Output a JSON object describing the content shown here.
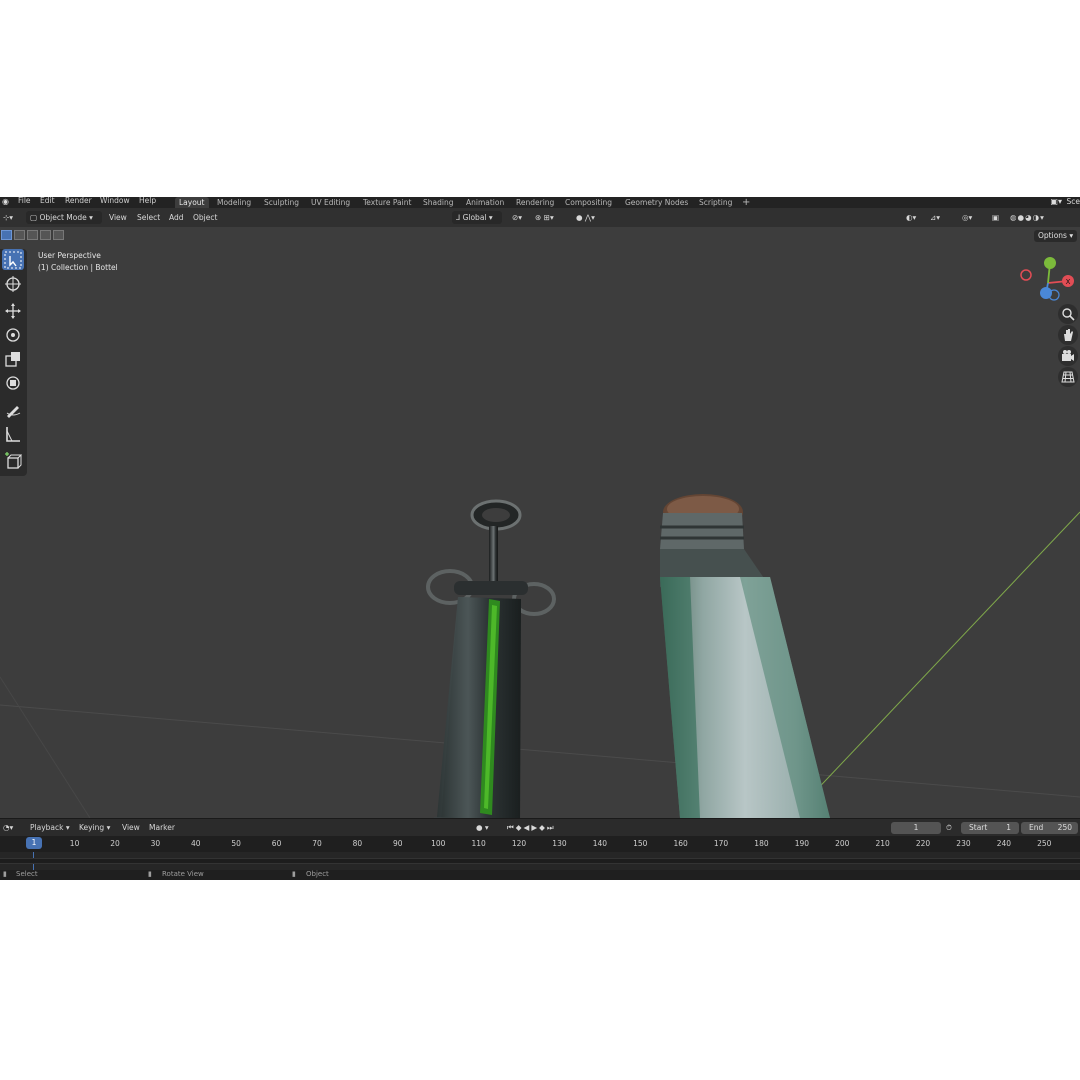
{
  "topbar": {
    "menus": [
      "File",
      "Edit",
      "Render",
      "Window",
      "Help"
    ],
    "workspaces": [
      "Layout",
      "Modeling",
      "Sculpting",
      "UV Editing",
      "Texture Paint",
      "Shading",
      "Animation",
      "Rendering",
      "Compositing",
      "Geometry Nodes",
      "Scripting"
    ],
    "active_workspace": "Layout",
    "add_tab": "+",
    "scene_label": "Sce"
  },
  "header": {
    "mode": "Object Mode",
    "menus": [
      "View",
      "Select",
      "Add",
      "Object"
    ],
    "transform_orientation": "Global",
    "options": "Options"
  },
  "viewport": {
    "perspective": "User Perspective",
    "collection": "(1) Collection | Bottel",
    "gizmo": {
      "x_label": "X",
      "colors": {
        "x": "#e24d55",
        "y": "#7cba3b",
        "z": "#4a88d8"
      }
    }
  },
  "timeline": {
    "menus": [
      "Playback",
      "Keying",
      "View",
      "Marker"
    ],
    "current_frame": "1",
    "start_label": "Start",
    "start_value": "1",
    "end_label": "End",
    "end_value": "250",
    "ruler_marker": "1",
    "ticks": [
      "10",
      "20",
      "30",
      "40",
      "50",
      "60",
      "70",
      "80",
      "90",
      "100",
      "110",
      "120",
      "130",
      "140",
      "150",
      "160",
      "170",
      "180",
      "190",
      "200",
      "210",
      "220",
      "230",
      "240",
      "250"
    ]
  },
  "statusbar": {
    "items": [
      "Select",
      "Rotate View",
      "Object"
    ]
  },
  "colors": {
    "accent": "#4772b3",
    "background": "#3d3d3d",
    "panel": "#303030"
  }
}
